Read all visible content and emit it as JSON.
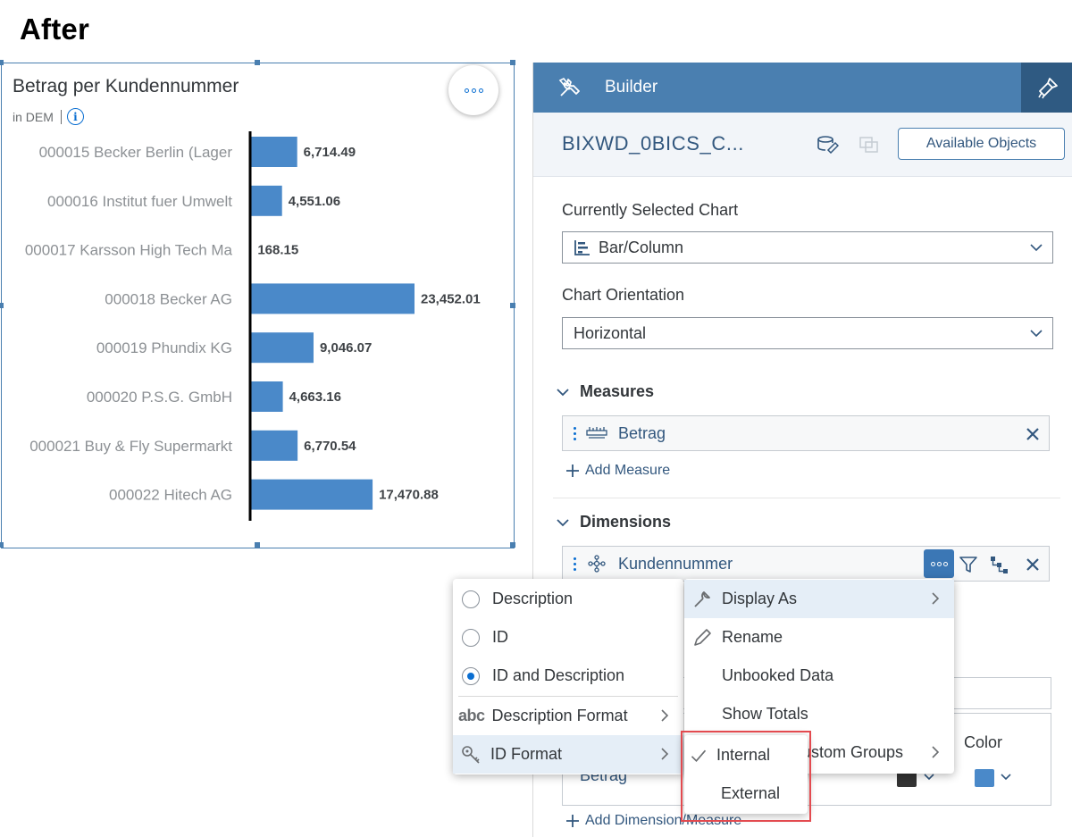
{
  "heading": "After",
  "chart": {
    "title": "Betrag per Kundennummer",
    "unit": "in DEM",
    "info_glyph": "i"
  },
  "chart_data": {
    "type": "bar",
    "orientation": "horizontal",
    "title": "Betrag per Kundennummer",
    "subtitle": "in DEM",
    "categories": [
      "000015 Becker Berlin (Lager",
      "000016 Institut fuer Umwelt",
      "000017 Karsson High Tech Ma",
      "000018 Becker AG",
      "000019 Phundix KG",
      "000020 P.S.G. GmbH",
      "000021 Buy & Fly Supermarkt",
      "000022 Hitech AG"
    ],
    "values": [
      6714.49,
      4551.06,
      168.15,
      23452.01,
      9046.07,
      4663.16,
      6770.54,
      17470.88
    ],
    "value_labels": [
      "6,714.49",
      "4,551.06",
      "168.15",
      "23,452.01",
      "9,046.07",
      "4,663.16",
      "6,770.54",
      "17,470.88"
    ],
    "xlim": [
      0,
      23452.01
    ],
    "bar_color": "#4a89c9",
    "grid": false
  },
  "builder": {
    "title": "Builder",
    "model_name": "BIXWD_0BICS_C...",
    "available_objects": "Available Objects",
    "selected_chart_label": "Currently Selected Chart",
    "selected_chart_value": "Bar/Column",
    "orientation_label": "Chart Orientation",
    "orientation_value": "Horizontal",
    "measures_label": "Measures",
    "measure_token": "Betrag",
    "add_measure": "Add Measure",
    "dimensions_label": "Dimensions",
    "dimension_token": "Kundennummer",
    "color_label": "Color",
    "color_row_label": "Betrag",
    "add_dim_measure": "Add Dimension/Measure",
    "accent": "#4a7fb0",
    "swatch_color": "#4a89c9"
  },
  "menu_display": {
    "items": [
      "Description",
      "ID",
      "ID and Description",
      "Description Format",
      "ID Format"
    ]
  },
  "menu_main": {
    "items": [
      "Display As",
      "Rename",
      "Unbooked Data",
      "Show Totals",
      "ustom Groups"
    ]
  },
  "menu_format": {
    "items": [
      "Internal",
      "External"
    ]
  },
  "icons": {
    "builder": "tools-icon",
    "styling": "paintbrush-icon",
    "measure": "measure-ruler-icon",
    "dimension": "hierarchy-dimension-icon"
  }
}
